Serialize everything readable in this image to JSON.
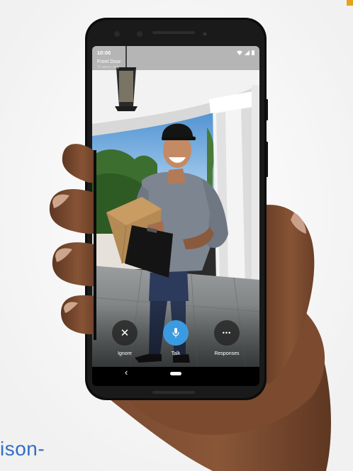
{
  "status_bar": {
    "time": "10:00",
    "wifi_icon": "wifi-icon",
    "signal_icon": "signal-icon",
    "battery_icon": "battery-icon"
  },
  "camera": {
    "title": "Front Door",
    "subtitle": "7s since ring"
  },
  "actions": {
    "ignore": {
      "label": "Ignore",
      "icon": "close-icon",
      "glyph": "✕"
    },
    "talk": {
      "label": "Talk",
      "icon": "microphone-icon"
    },
    "responses": {
      "label": "Responses",
      "icon": "more-horizontal-icon",
      "glyph": "•••"
    }
  },
  "nav_bar": {
    "back_glyph": "‹"
  },
  "page": {
    "cut_text": "ison-"
  },
  "colors": {
    "talk_button": "#3b9be0",
    "shirt": "#7d8590",
    "jeans": "#2a3550",
    "sky": "#6fa9d8",
    "skin_hand": "#6a402a"
  }
}
